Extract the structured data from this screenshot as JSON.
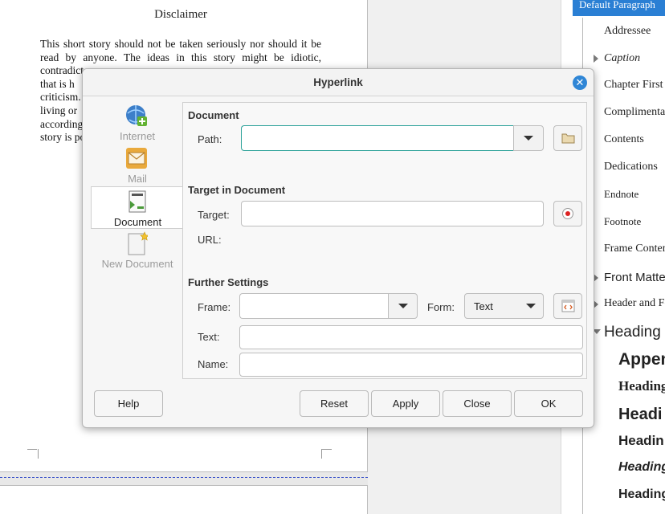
{
  "document": {
    "title": "Disclaimer",
    "lines": [
      "This short story should not be taken seriously nor should it be",
      "read by anyone. The ideas in this story might be idiotic,",
      "contradict",
      "that is h",
      "criticism.",
      "living or",
      "according",
      "story is po"
    ]
  },
  "styles_panel": {
    "items": [
      {
        "label": "Default Paragraph",
        "selected": true
      },
      {
        "label": "Addressee"
      },
      {
        "label": "Caption",
        "expandable": true
      },
      {
        "label": "Chapter First P"
      },
      {
        "label": "Complimenta"
      },
      {
        "label": "Contents"
      },
      {
        "label": "Dedications"
      },
      {
        "label": "Endnote"
      },
      {
        "label": "Footnote"
      },
      {
        "label": "Frame Conten"
      },
      {
        "label": "Front Matte",
        "expandable": true
      },
      {
        "label": "Header and Fo",
        "expandable": true
      },
      {
        "label": "Heading",
        "expandable": true,
        "open": true
      },
      {
        "label": "Appen"
      },
      {
        "label": "Heading"
      },
      {
        "label": "Headi"
      },
      {
        "label": "Headin"
      },
      {
        "label": "Heading"
      },
      {
        "label": "Heading"
      }
    ]
  },
  "dialog": {
    "title": "Hyperlink",
    "close_icon": "close-icon",
    "tabs": [
      {
        "label": "Internet",
        "icon": "globe-link-icon",
        "active": false
      },
      {
        "label": "Mail",
        "icon": "envelope-icon",
        "active": false
      },
      {
        "label": "Document",
        "icon": "document-link-icon",
        "active": true
      },
      {
        "label": "New Document",
        "icon": "new-document-icon",
        "active": false
      }
    ],
    "document_section": {
      "heading": "Document",
      "path_label": "Path:",
      "path_value": "",
      "browse_icon": "folder-icon"
    },
    "target_section": {
      "heading": "Target in Document",
      "target_label": "Target:",
      "target_value": "",
      "url_label": "URL:",
      "url_value": "",
      "target_icon": "target-icon"
    },
    "further_settings": {
      "heading": "Further Settings",
      "frame_label": "Frame:",
      "frame_value": "",
      "form_label": "Form:",
      "form_value": "Text",
      "events_icon": "events-icon",
      "text_label": "Text:",
      "text_value": "",
      "name_label": "Name:",
      "name_value": ""
    },
    "buttons": {
      "help": "Help",
      "reset": "Reset",
      "apply": "Apply",
      "close": "Close",
      "ok": "OK"
    }
  }
}
